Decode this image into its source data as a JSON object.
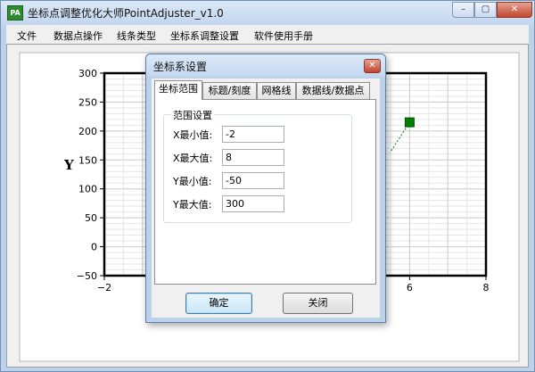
{
  "window": {
    "title": "坐标点调整优化大师PointAdjuster_v1.0",
    "app_icon_text": "PA",
    "controls": {
      "minimize": "–",
      "maximize": "▢",
      "close": "✕"
    }
  },
  "menu": [
    {
      "label": "文件"
    },
    {
      "label": "数据点操作"
    },
    {
      "label": "线条类型"
    },
    {
      "label": "坐标系调整设置"
    },
    {
      "label": "软件使用手册"
    }
  ],
  "chart_data": {
    "type": "line",
    "xlim": [
      -2,
      8
    ],
    "ylim": [
      -50,
      300
    ],
    "x_ticks": [
      -2,
      6,
      8
    ],
    "y_ticks": [
      -50,
      0,
      50,
      100,
      150,
      200,
      250,
      300
    ],
    "ylabel": "Y",
    "grid": true,
    "series": [
      {
        "points": [
          {
            "x": 6,
            "y": 215
          }
        ],
        "color": "#008000"
      }
    ]
  },
  "dialog": {
    "title": "坐标系设置",
    "close": "✕",
    "tabs": [
      {
        "label": "坐标范围",
        "active": true
      },
      {
        "label": "标题/刻度",
        "active": false
      },
      {
        "label": "网格线",
        "active": false
      },
      {
        "label": "数据线/数据点",
        "active": false
      }
    ],
    "group_title": "范围设置",
    "fields": {
      "xmin": {
        "label": "X最小值:",
        "value": "-2"
      },
      "xmax": {
        "label": "X最大值:",
        "value": "8"
      },
      "ymin": {
        "label": "Y最小值:",
        "value": "-50"
      },
      "ymax": {
        "label": "Y最大值:",
        "value": "300"
      }
    },
    "ok_label": "确定",
    "close_label": "关闭"
  }
}
